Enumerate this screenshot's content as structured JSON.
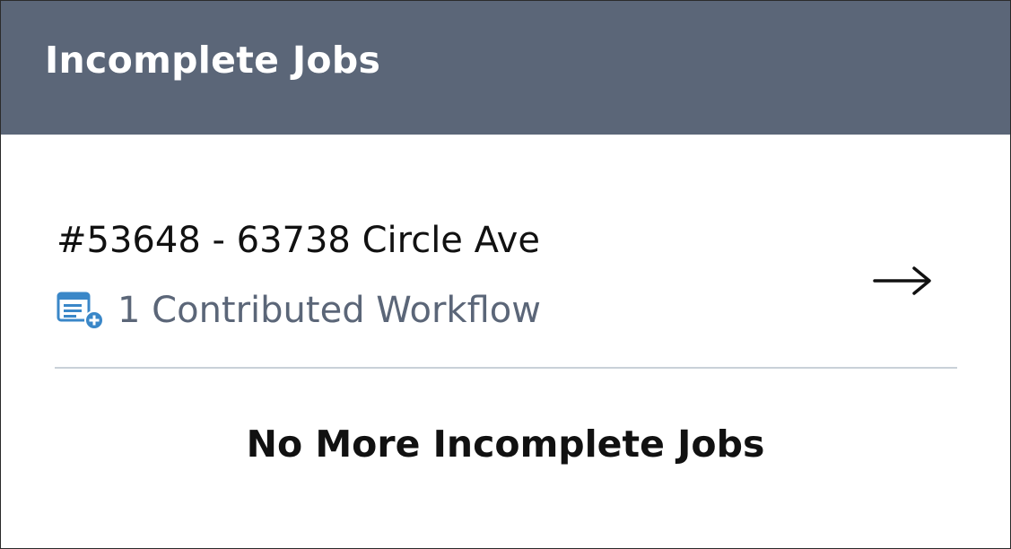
{
  "header": {
    "title": "Incomplete Jobs"
  },
  "jobs": [
    {
      "title": "#53648 - 63738 Circle Ave",
      "workflow_text": "1 Contributed Workflow",
      "workflow_icon": "document-add-icon",
      "action_icon": "arrow-right-icon"
    }
  ],
  "footer": {
    "message": "No More Incomplete Jobs"
  },
  "colors": {
    "header_bg": "#5b6678",
    "header_text": "#ffffff",
    "muted_text": "#5b6678",
    "icon_accent": "#3a87c8",
    "divider": "#c9d1d8"
  }
}
